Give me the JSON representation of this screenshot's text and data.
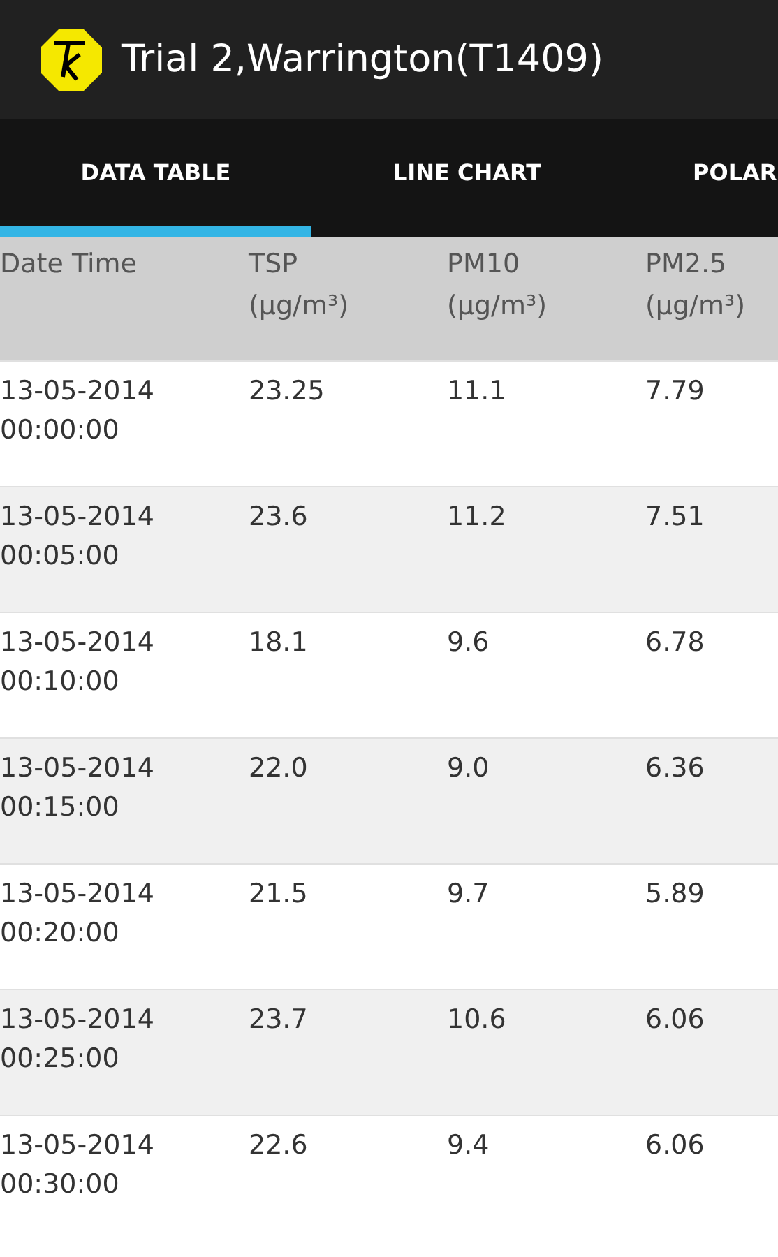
{
  "app_bar": {
    "title": "Trial 2,Warrington(T1409)"
  },
  "tabs": [
    {
      "label": "DATA TABLE",
      "selected": true
    },
    {
      "label": "LINE CHART",
      "selected": false
    },
    {
      "label": "POLAR",
      "selected": false
    }
  ],
  "table": {
    "columns": [
      {
        "name": "Date Time"
      },
      {
        "name": "TSP",
        "unit": "(µg/m³)"
      },
      {
        "name": "PM10",
        "unit": "(µg/m³)"
      },
      {
        "name": "PM2.5",
        "unit": "(µg/m³)"
      }
    ],
    "rows": [
      {
        "date": "13-05-2014",
        "time": "00:00:00",
        "values": [
          "23.25",
          "11.1",
          "7.79"
        ]
      },
      {
        "date": "13-05-2014",
        "time": "00:05:00",
        "values": [
          "23.6",
          "11.2",
          "7.51"
        ]
      },
      {
        "date": "13-05-2014",
        "time": "00:10:00",
        "values": [
          "18.1",
          "9.6",
          "6.78"
        ]
      },
      {
        "date": "13-05-2014",
        "time": "00:15:00",
        "values": [
          "22.0",
          "9.0",
          "6.36"
        ]
      },
      {
        "date": "13-05-2014",
        "time": "00:20:00",
        "values": [
          "21.5",
          "9.7",
          "5.89"
        ]
      },
      {
        "date": "13-05-2014",
        "time": "00:25:00",
        "values": [
          "23.7",
          "10.6",
          "6.06"
        ]
      },
      {
        "date": "13-05-2014",
        "time": "00:30:00",
        "values": [
          "22.6",
          "9.4",
          "6.06"
        ]
      }
    ]
  }
}
